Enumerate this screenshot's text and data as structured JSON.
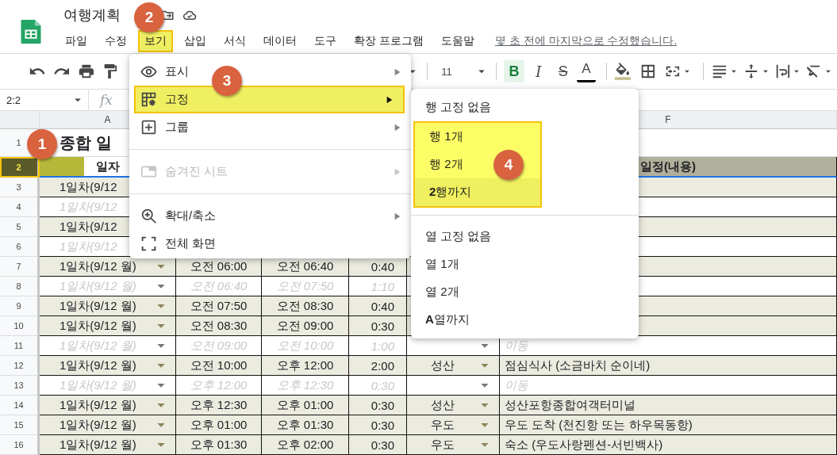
{
  "app": {
    "title": "여행계획",
    "last_edit": "몇 초 전에 마지막으로 수정했습니다.",
    "menus": [
      {
        "label": "파일",
        "selected": false
      },
      {
        "label": "수정",
        "selected": false
      },
      {
        "label": "보기",
        "selected": true
      },
      {
        "label": "삽입",
        "selected": false
      },
      {
        "label": "서식",
        "selected": false
      },
      {
        "label": "데이터",
        "selected": false
      },
      {
        "label": "도구",
        "selected": false
      },
      {
        "label": "확장 프로그램",
        "selected": false
      },
      {
        "label": "도움말",
        "selected": false
      }
    ]
  },
  "toolbar": {
    "font_size": "11",
    "format_buttons": [
      {
        "kind": "bold",
        "label": "B",
        "selected": true
      },
      {
        "kind": "italic",
        "label": "I",
        "selected": false
      },
      {
        "kind": "strike",
        "label": "S",
        "selected": false
      },
      {
        "kind": "color",
        "label": "A",
        "selected": false
      }
    ]
  },
  "formula_bar": {
    "cell_ref": "2:2",
    "fx_label": "fx"
  },
  "column_headers": {
    "column_a": "A",
    "column_f": "F"
  },
  "rows": [
    {
      "number": "1",
      "kind": "title",
      "selected": false,
      "highlighted": false,
      "title": "종합 일"
    },
    {
      "number": "2",
      "kind": "header",
      "selected": true,
      "highlighted": true,
      "date": "일자",
      "content": "일정(내용)"
    },
    {
      "number": "3",
      "kind": "activity",
      "selected": false,
      "highlighted": false,
      "date": "1일차(9/12"
    },
    {
      "number": "4",
      "kind": "transit",
      "selected": false,
      "highlighted": false,
      "date": "1일차(9/12"
    },
    {
      "number": "5",
      "kind": "activity",
      "selected": false,
      "highlighted": false,
      "date": "1일차(9/12"
    },
    {
      "number": "6",
      "kind": "transit",
      "selected": false,
      "highlighted": false,
      "date": "1일차(9/12"
    },
    {
      "number": "7",
      "kind": "activity",
      "selected": false,
      "highlighted": false,
      "date": "1일차(9/12 월)",
      "start": "오전 06:00",
      "end": "오전 06:40",
      "duration": "0:40"
    },
    {
      "number": "8",
      "kind": "transit",
      "selected": false,
      "highlighted": false,
      "date": "1일차(9/12 월)",
      "start": "오전 06:40",
      "end": "오전 07:50",
      "duration": "1:10"
    },
    {
      "number": "9",
      "kind": "activity",
      "selected": false,
      "highlighted": false,
      "date": "1일차(9/12 월)",
      "start": "오전 07:50",
      "end": "오전 08:30",
      "duration": "0:40"
    },
    {
      "number": "10",
      "kind": "activity",
      "selected": false,
      "highlighted": false,
      "date": "1일차(9/12 월)",
      "start": "오전 08:30",
      "end": "오전 09:00",
      "duration": "0:30"
    },
    {
      "number": "11",
      "kind": "transit",
      "selected": false,
      "highlighted": false,
      "date": "1일차(9/12 월)",
      "start": "오전 09:00",
      "end": "오전 10:00",
      "duration": "1:00",
      "content": "이동"
    },
    {
      "number": "12",
      "kind": "activity",
      "selected": false,
      "highlighted": false,
      "date": "1일차(9/12 월)",
      "start": "오전 10:00",
      "end": "오후 12:00",
      "duration": "2:00",
      "place": "성산",
      "content": "점심식사 (소금바치 순이네)"
    },
    {
      "number": "13",
      "kind": "transit",
      "selected": false,
      "highlighted": false,
      "date": "1일차(9/12 월)",
      "start": "오후 12:00",
      "end": "오후 12:30",
      "duration": "0:30",
      "content": "이동"
    },
    {
      "number": "14",
      "kind": "activity",
      "selected": false,
      "highlighted": false,
      "date": "1일차(9/12 월)",
      "start": "오후 12:30",
      "end": "오후 01:00",
      "duration": "0:30",
      "place": "성산",
      "content": "성산포항종합여객터미널"
    },
    {
      "number": "15",
      "kind": "activity",
      "selected": false,
      "highlighted": false,
      "date": "1일차(9/12 월)",
      "start": "오후 01:00",
      "end": "오후 01:30",
      "duration": "0:30",
      "place": "우도",
      "content": "우도 도착 (천진항 또는 하우목동항)"
    },
    {
      "number": "16",
      "kind": "activity",
      "selected": false,
      "highlighted": false,
      "date": "1일차(9/12 월)",
      "start": "오후 01:30",
      "end": "오후 02:00",
      "duration": "0:30",
      "place": "우도",
      "content": "숙소 (우도사랑펜션-서빈백사)"
    }
  ],
  "view_menu": {
    "items": [
      {
        "kind": "submenu",
        "label": "표시",
        "selected": false,
        "disabled": false
      },
      {
        "kind": "submenu",
        "label": "고정",
        "selected": true,
        "disabled": false
      },
      {
        "kind": "submenu",
        "label": "그룹",
        "selected": false,
        "disabled": false
      },
      {
        "kind": "divider"
      },
      {
        "kind": "submenu",
        "label": "숨겨진 시트",
        "selected": false,
        "disabled": true
      },
      {
        "kind": "divider"
      },
      {
        "kind": "submenu",
        "label": "확대/축소",
        "selected": false,
        "disabled": false
      },
      {
        "kind": "action",
        "label": "전체 화면",
        "selected": false,
        "disabled": false
      }
    ]
  },
  "freeze_menu": {
    "items": [
      {
        "kind": "action",
        "label": "행 고정 없음",
        "selected": false,
        "highlighted": false
      },
      {
        "kind": "action",
        "label": "행 1개",
        "selected": false,
        "highlighted": true
      },
      {
        "kind": "action",
        "label": "행 2개",
        "selected": false,
        "highlighted": true
      },
      {
        "kind": "action",
        "label": "**2**행까지",
        "selected": true,
        "highlighted": true
      },
      {
        "kind": "divider"
      },
      {
        "kind": "action",
        "label": "열 고정 없음",
        "selected": false,
        "highlighted": false
      },
      {
        "kind": "action",
        "label": "열 1개",
        "selected": false,
        "highlighted": false
      },
      {
        "kind": "action",
        "label": "열 2개",
        "selected": false,
        "highlighted": false
      },
      {
        "kind": "action",
        "label": "**A**열까지",
        "selected": false,
        "highlighted": false
      }
    ]
  },
  "callouts": [
    {
      "number": "1"
    },
    {
      "number": "2"
    },
    {
      "number": "3"
    },
    {
      "number": "4"
    }
  ]
}
